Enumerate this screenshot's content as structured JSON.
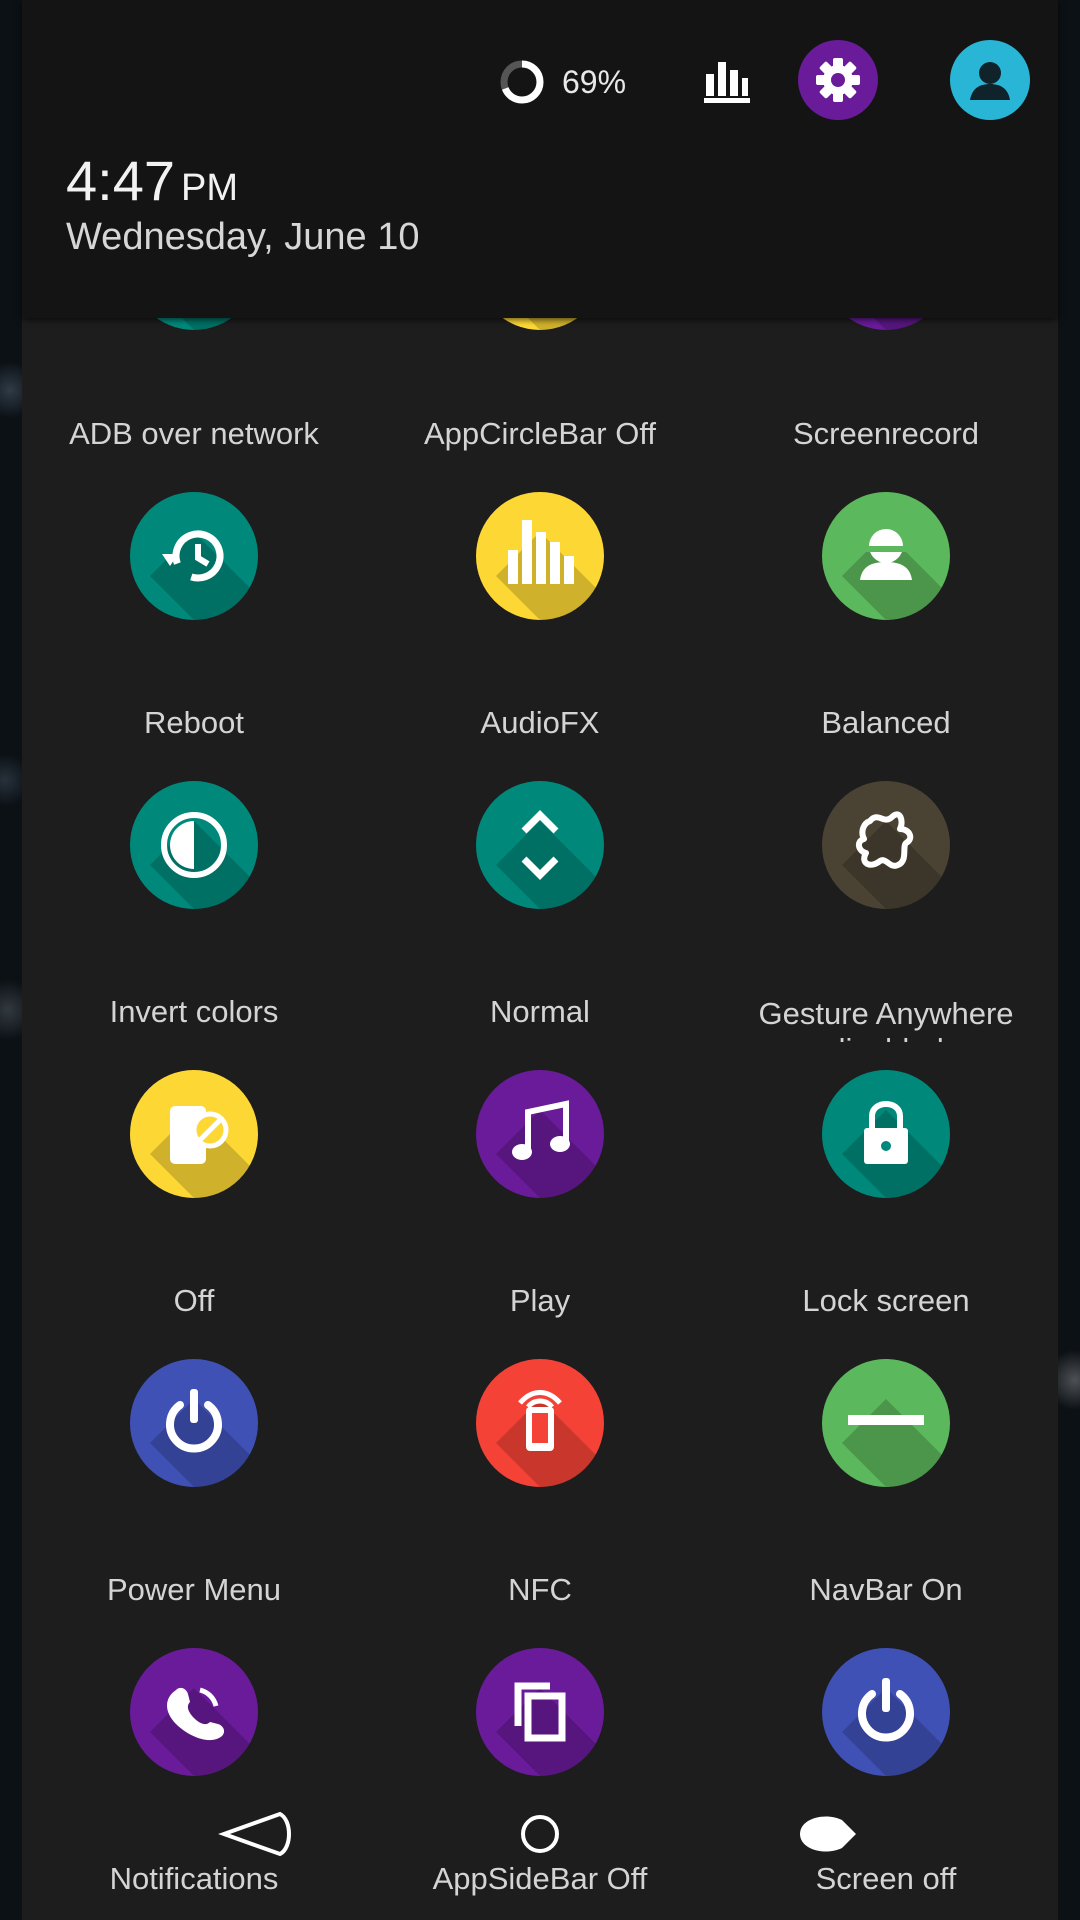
{
  "header": {
    "battery_percent": "69%",
    "battery_level": 0.69,
    "time": "4:47",
    "ampm": "PM",
    "date": "Wednesday, June 10",
    "icons": [
      "battery-ring-icon",
      "stats-icon",
      "settings-icon",
      "user-icon"
    ],
    "colors": {
      "settings": "#6a1b9a",
      "user": "#29b6d6"
    }
  },
  "tiles": [
    {
      "label": "ADB over network",
      "icon": "adb-icon",
      "color": "#00897b"
    },
    {
      "label": "AppCircleBar Off",
      "icon": "circle-bar-icon",
      "color": "#fdd835"
    },
    {
      "label": "Screenrecord",
      "icon": "screenrecord-icon",
      "color": "#6a1b9a"
    },
    {
      "label": "Reboot",
      "icon": "reboot-icon",
      "color": "#00897b"
    },
    {
      "label": "AudioFX",
      "icon": "equalizer-icon",
      "color": "#fdd835"
    },
    {
      "label": "Balanced",
      "icon": "profile-icon",
      "color": "#5cb85c"
    },
    {
      "label": "Invert colors",
      "icon": "invert-colors-icon",
      "color": "#00897b"
    },
    {
      "label": "Normal",
      "icon": "expand-icon",
      "color": "#00897b"
    },
    {
      "label": "Gesture Anywhere disabled",
      "icon": "gesture-icon",
      "color": "#4a4334"
    },
    {
      "label": "Off",
      "icon": "rotation-lock-icon",
      "color": "#fdd835"
    },
    {
      "label": "Play",
      "icon": "music-note-icon",
      "color": "#6a1b9a"
    },
    {
      "label": "Lock screen",
      "icon": "lock-icon",
      "color": "#00897b"
    },
    {
      "label": "Power Menu",
      "icon": "power-icon",
      "color": "#3f51b5"
    },
    {
      "label": "NFC",
      "icon": "nfc-icon",
      "color": "#f44336"
    },
    {
      "label": "NavBar On",
      "icon": "navbar-icon",
      "color": "#5cb85c"
    },
    {
      "label": "Notifications",
      "icon": "phone-icon",
      "color": "#6a1b9a"
    },
    {
      "label": "AppSideBar Off",
      "icon": "copy-icon",
      "color": "#6a1b9a"
    },
    {
      "label": "Screen off",
      "icon": "power-icon",
      "color": "#3f51b5"
    }
  ],
  "navbar": {
    "icons": [
      "back-icon",
      "home-icon",
      "recents-icon"
    ]
  }
}
